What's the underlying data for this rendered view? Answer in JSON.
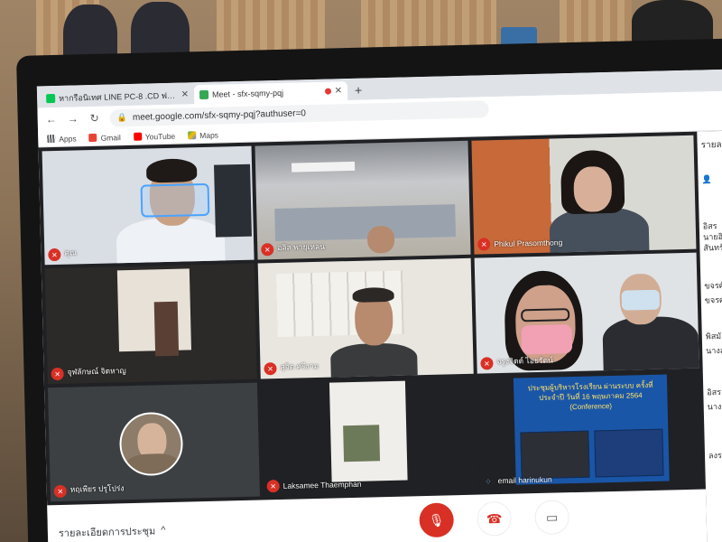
{
  "browser": {
    "tabs": [
      {
        "title": "หากรือนิเทศ LINE PC-8 .CD ฟร คาก 3",
        "active": false,
        "favicon_color": "#06c755",
        "icon": "line-icon"
      },
      {
        "title": "Meet - sfx-sqmy-pqj",
        "active": true,
        "favicon_color": "#34a853",
        "icon": "meet-icon"
      }
    ],
    "new_tab_label": "+",
    "url": "meet.google.com/sfx-sqmy-pqj?authuser=0",
    "bookmarks": [
      {
        "label": "Apps",
        "icon": "apps-grid-icon",
        "color": "#5f6368"
      },
      {
        "label": "Gmail",
        "icon": "gmail-icon",
        "color": "#ea4335"
      },
      {
        "label": "YouTube",
        "icon": "youtube-icon",
        "color": "#ff0000"
      },
      {
        "label": "Maps",
        "icon": "maps-icon",
        "color": "#34a853"
      }
    ]
  },
  "meet": {
    "participants": [
      {
        "name": "คุณ",
        "muted": true
      },
      {
        "name": "อลิส พายุเหลน",
        "muted": true
      },
      {
        "name": "Phikul Prasomthong",
        "muted": true
      },
      {
        "name": "จุฬลักษณ์ จิตหาญ",
        "muted": true
      },
      {
        "name": "สุจิต ศรีงาม",
        "muted": true
      },
      {
        "name": "จรูงจิตต์ ไอยรัตน์",
        "muted": true
      },
      {
        "name": "หฤเพียร ปรุโปร่ง",
        "muted": true
      },
      {
        "name": "Laksamee Thaemphan",
        "muted": true
      },
      {
        "name": "email harinukun",
        "muted": false
      }
    ],
    "slide_text": "ประชุมผู้บริหารโรงเรียน ผ่านระบบ ครั้งที่ ประจำปี วันที่ 16 พฤษภาคม 2564 (Conference)",
    "side_panel": {
      "title": "รายละ",
      "lines": [
        "อิสร",
        "นายอิ",
        "สันทรั",
        "ขจรศั",
        "ขจรศ",
        "พิสมั",
        "นางส",
        "อิสร",
        "นางส",
        "ลงร"
      ]
    },
    "meeting_details_label": "รายละเอียดการประชุม",
    "chevron": "^"
  },
  "colors": {
    "accent_red": "#d93025",
    "meet_dark": "#202124"
  }
}
